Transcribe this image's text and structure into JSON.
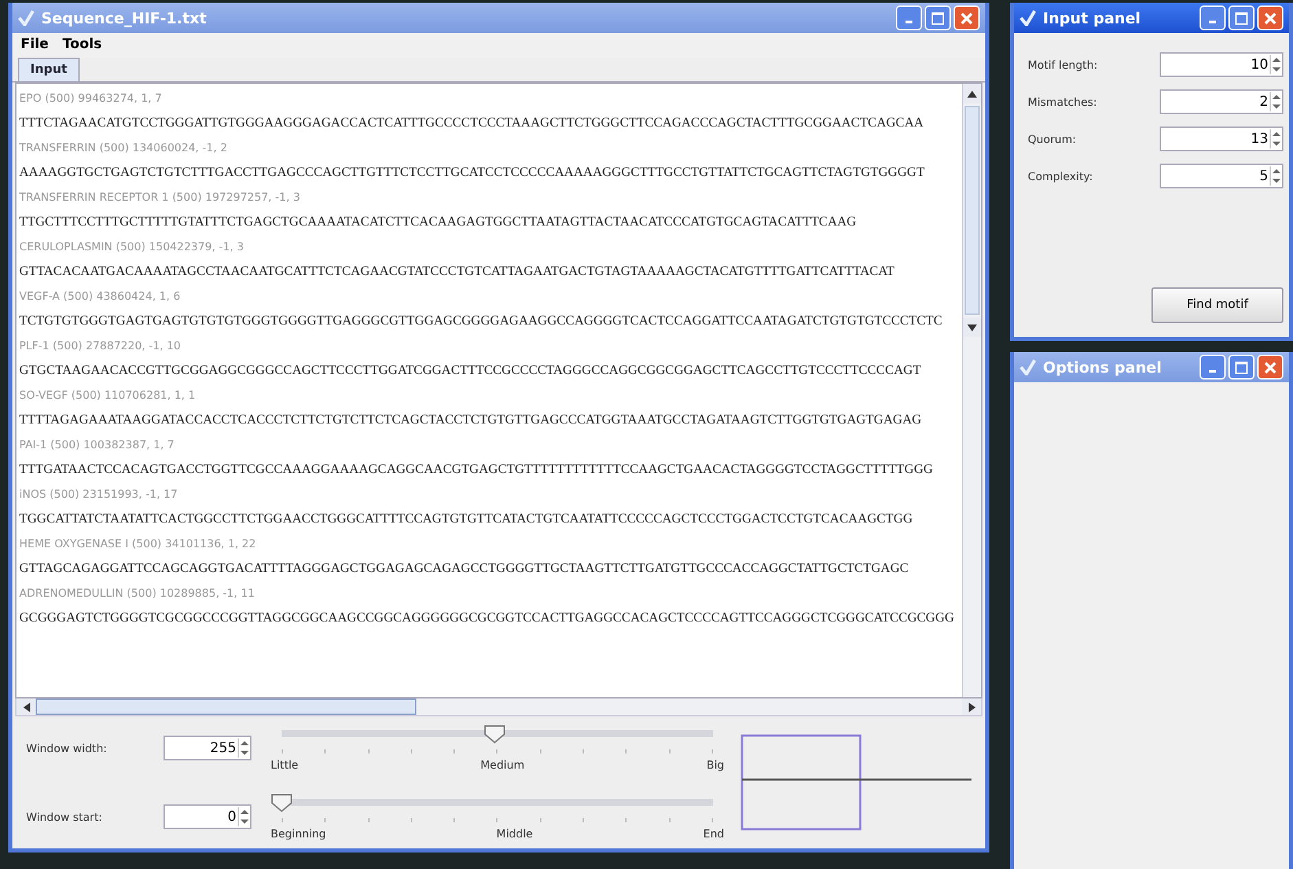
{
  "main_window": {
    "title": "Sequence_HIF-1.txt",
    "active": false,
    "menu": [
      "File",
      "Tools"
    ],
    "tabs": [
      {
        "label": "Input",
        "selected": true
      }
    ],
    "sequences": [
      {
        "header": "EPO (500) 99463274, 1, 7",
        "sequence": "TTTCTAGAACATGTCCTGGGATTGTGGGAAGGGAGACCACTCATTTGCCCCTCCCTAAAGCTTCTGGGCTTCCAGACCCAGCTACTTTGCGGAACTCAGCAA"
      },
      {
        "header": "TRANSFERRIN (500) 134060024, -1, 2",
        "sequence": "AAAAGGTGCTGAGTCTGTCTTTGACCTTGAGCCCAGCTTGTTTCTCCTTGCATCCTCCCCCAAAAAGGGCTTTGCCTGTTATTCTGCAGTTCTAGTGTGGGGT"
      },
      {
        "header": "TRANSFERRIN RECEPTOR 1 (500) 197297257, -1, 3",
        "sequence": "TTGCTTTCCTTTGCTTTTTGTATTTCTGAGCTGCAAAATACATCTTCACAAGAGTGGCTTAATAGTTACTAACATCCCATGTGCAGTACATTTCAAG"
      },
      {
        "header": "CERULOPLASMIN (500) 150422379, -1, 3",
        "sequence": "GTTACACAATGACAAAATAGCCTAACAATGCATTTCTCAGAACGTATCCCTGTCATTAGAATGACTGTAGTAAAAAGCTACATGTTTTGATTCATTTACAT"
      },
      {
        "header": "VEGF-A (500) 43860424, 1, 6",
        "sequence": "TCTGTGTGGGTGAGTGAGTGTGTGTGGGTGGGGTTGAGGGCGTTGGAGCGGGGAGAAGGCCAGGGGTCACTCCAGGATTCCAATAGATCTGTGTGTCCCTCTC"
      },
      {
        "header": "PLF-1 (500) 27887220, -1, 10",
        "sequence": "GTGCTAAGAACACCGTTGCGGAGGCGGGCCAGCTTCCCTTGGATCGGACTTTCCGCCCCTAGGGCCAGGCGGCGGAGCTTCAGCCTTGTCCCTTCCCCAGT"
      },
      {
        "header": "SO-VEGF (500) 110706281, 1, 1",
        "sequence": "TTTTAGAGAAATAAGGATACCACCTCACCCTCTTCTGTCTTCTCAGCTACCTCTGTGTTGAGCCCATGGTAAATGCCTAGATAAGTCTTGGTGTGAGTGAGAG"
      },
      {
        "header": "PAI-1 (500) 100382387, 1, 7",
        "sequence": "TTTGATAACTCCACAGTGACCTGGTTCGCCAAAGGAAAAGCAGGCAACGTGAGCTGTTTTTTTTTTTTCCAAGCTGAACACTAGGGGTCCTAGGCTTTTTGGG"
      },
      {
        "header": "iNOS (500) 23151993, -1, 17",
        "sequence": "TGGCATTATCTAATATTCACTGGCCTTCTGGAACCTGGGCATTTTCCAGTGTGTTCATACTGTCAATATTCCCCCAGCTCCCTGGACTCCTGTCACAAGCTGG"
      },
      {
        "header": "HEME OXYGENASE I (500) 34101136, 1, 22",
        "sequence": "GTTAGCAGAGGATTCCAGCAGGTGACATTTTAGGGAGCTGGAGAGCAGAGCCTGGGGTTGCTAAGTTCTTGATGTTGCCCACCAGGCTATTGCTCTGAGC"
      },
      {
        "header": "ADRENOMEDULLIN (500) 10289885, -1, 11",
        "sequence": "GCGGGAGTCTGGGGTCGCGGCCCGGTTAGGCGGCAAGCCGGCAGGGGGGCGCGGTCCACTTGAGGCCACAGCTCCCCAGTTCCAGGGCTCGGGCATCCGCGGG"
      }
    ],
    "controls": [
      {
        "label": "Window width:",
        "value": "255",
        "level": 0.47,
        "ticks": [
          "Little",
          "Medium",
          "Big"
        ]
      },
      {
        "label": "Window start:",
        "value": "0",
        "level": 0,
        "ticks": [
          "Beginning",
          "Middle",
          "End"
        ]
      }
    ]
  },
  "input_panel": {
    "title": "Input panel",
    "active": true,
    "fields": [
      {
        "label": "Motif length:",
        "value": "10"
      },
      {
        "label": "Mismatches:",
        "value": "2"
      },
      {
        "label": "Quorum:",
        "value": "13"
      },
      {
        "label": "Complexity:",
        "value": "5"
      }
    ],
    "button": "Find motif"
  },
  "options_panel": {
    "title": "Options panel",
    "active": false
  }
}
